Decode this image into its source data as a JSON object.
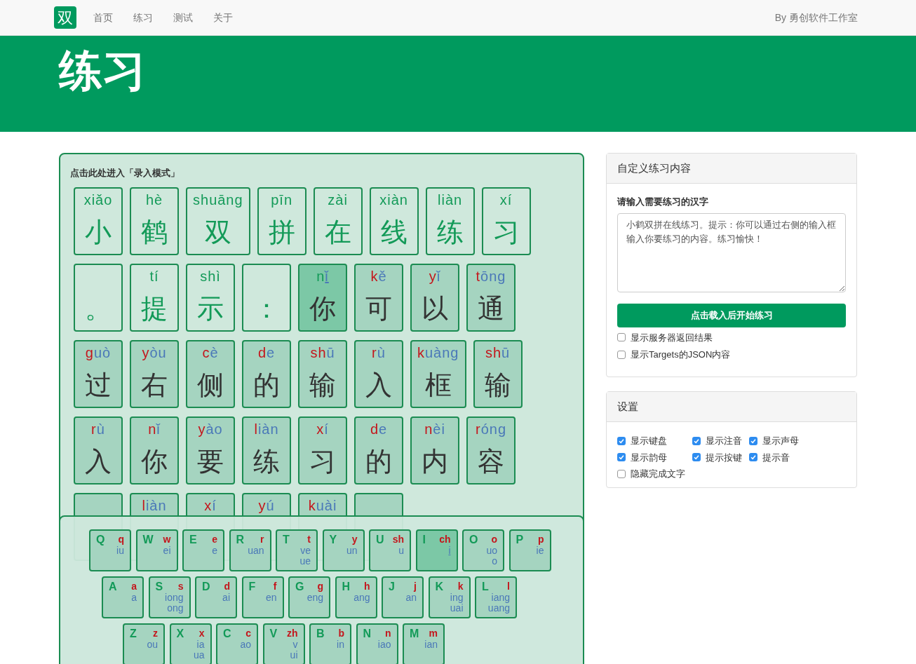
{
  "navbar": {
    "logo": "双",
    "links": [
      "首页",
      "练习",
      "测试",
      "关于"
    ],
    "credit": "By 勇创软件工作室"
  },
  "hero": {
    "title": "练习"
  },
  "practice": {
    "hint": "点击此处进入「录入模式」",
    "rows": [
      [
        {
          "char": "小",
          "initial": "x",
          "final": "iǎo",
          "done": true,
          "selected": false
        },
        {
          "char": "鹤",
          "initial": "h",
          "final": "è",
          "done": true,
          "selected": false
        },
        {
          "char": "双",
          "initial": "sh",
          "final": "uāng",
          "done": true,
          "selected": false
        },
        {
          "char": "拼",
          "initial": "p",
          "final": "īn",
          "done": true,
          "selected": false
        },
        {
          "char": "在",
          "initial": "z",
          "final": "ài",
          "done": true,
          "selected": false
        },
        {
          "char": "线",
          "initial": "x",
          "final": "iàn",
          "done": true,
          "selected": false
        },
        {
          "char": "练",
          "initial": "l",
          "final": "iàn",
          "done": true,
          "selected": false
        },
        {
          "char": "习",
          "initial": "x",
          "final": "í",
          "done": true,
          "selected": false
        }
      ],
      [
        {
          "char": "。",
          "done": true,
          "selected": false
        },
        {
          "char": "提",
          "initial": "t",
          "final": "í",
          "done": true,
          "selected": false
        },
        {
          "char": "示",
          "initial": "sh",
          "final": "ì",
          "done": true,
          "selected": false
        },
        {
          "char": "：",
          "done": true,
          "selected": false
        },
        {
          "char": "你",
          "initial": "n",
          "final": "ǐ",
          "done": false,
          "selected": true
        },
        {
          "char": "可",
          "initial": "k",
          "final": "ě",
          "done": false,
          "selected": false
        },
        {
          "char": "以",
          "initial": "y",
          "final": "ǐ",
          "done": false,
          "selected": false
        },
        {
          "char": "通",
          "initial": "t",
          "final": "ōng",
          "done": false,
          "selected": false
        }
      ],
      [
        {
          "char": "过",
          "initial": "g",
          "final": "uò",
          "done": false,
          "selected": false
        },
        {
          "char": "右",
          "initial": "y",
          "final": "òu",
          "done": false,
          "selected": false
        },
        {
          "char": "侧",
          "initial": "c",
          "final": "è",
          "done": false,
          "selected": false
        },
        {
          "char": "的",
          "initial": "d",
          "final": "e",
          "done": false,
          "selected": false
        },
        {
          "char": "输",
          "initial": "sh",
          "final": "ū",
          "done": false,
          "selected": false
        },
        {
          "char": "入",
          "initial": "r",
          "final": "ù",
          "done": false,
          "selected": false
        },
        {
          "char": "框",
          "initial": "k",
          "final": "uàng",
          "done": false,
          "selected": false
        },
        {
          "char": "输",
          "initial": "sh",
          "final": "ū",
          "done": false,
          "selected": false
        }
      ],
      [
        {
          "char": "入",
          "initial": "r",
          "final": "ù",
          "done": false,
          "selected": false
        },
        {
          "char": "你",
          "initial": "n",
          "final": "ǐ",
          "done": false,
          "selected": false
        },
        {
          "char": "要",
          "initial": "y",
          "final": "ào",
          "done": false,
          "selected": false
        },
        {
          "char": "练",
          "initial": "l",
          "final": "iàn",
          "done": false,
          "selected": false
        },
        {
          "char": "习",
          "initial": "x",
          "final": "í",
          "done": false,
          "selected": false
        },
        {
          "char": "的",
          "initial": "d",
          "final": "e",
          "done": false,
          "selected": false
        },
        {
          "char": "内",
          "initial": "n",
          "final": "èi",
          "done": false,
          "selected": false
        },
        {
          "char": "容",
          "initial": "r",
          "final": "óng",
          "done": false,
          "selected": false
        }
      ],
      [
        {
          "done": false,
          "selected": false
        },
        {
          "initial": "l",
          "final": "iàn",
          "done": false,
          "selected": false
        },
        {
          "initial": "x",
          "final": "í",
          "done": false,
          "selected": false
        },
        {
          "initial": "y",
          "final": "ú",
          "done": false,
          "selected": false
        },
        {
          "initial": "k",
          "final": "uài",
          "done": false,
          "selected": false
        },
        {
          "done": false,
          "selected": false
        }
      ]
    ]
  },
  "keyboard": {
    "rows": [
      [
        {
          "letter": "Q",
          "initial": "q",
          "finals": [
            "iu"
          ],
          "selected": false
        },
        {
          "letter": "W",
          "initial": "w",
          "finals": [
            "ei"
          ],
          "selected": false
        },
        {
          "letter": "E",
          "initial": "e",
          "finals": [
            "e"
          ],
          "selected": false
        },
        {
          "letter": "R",
          "initial": "r",
          "finals": [
            "uan"
          ],
          "selected": false
        },
        {
          "letter": "T",
          "initial": "t",
          "finals": [
            "ve",
            "ue"
          ],
          "selected": false
        },
        {
          "letter": "Y",
          "initial": "y",
          "finals": [
            "un"
          ],
          "selected": false
        },
        {
          "letter": "U",
          "initial": "sh",
          "finals": [
            "u"
          ],
          "selected": false
        },
        {
          "letter": "I",
          "initial": "ch",
          "finals": [
            "i"
          ],
          "selected": true
        },
        {
          "letter": "O",
          "initial": "o",
          "finals": [
            "uo",
            "o"
          ],
          "selected": false
        },
        {
          "letter": "P",
          "initial": "p",
          "finals": [
            "ie"
          ],
          "selected": false
        }
      ],
      [
        {
          "letter": "A",
          "initial": "a",
          "finals": [
            "a"
          ],
          "selected": false
        },
        {
          "letter": "S",
          "initial": "s",
          "finals": [
            "iong",
            "ong"
          ],
          "selected": false
        },
        {
          "letter": "D",
          "initial": "d",
          "finals": [
            "ai"
          ],
          "selected": false
        },
        {
          "letter": "F",
          "initial": "f",
          "finals": [
            "en"
          ],
          "selected": false
        },
        {
          "letter": "G",
          "initial": "g",
          "finals": [
            "eng"
          ],
          "selected": false
        },
        {
          "letter": "H",
          "initial": "h",
          "finals": [
            "ang"
          ],
          "selected": false
        },
        {
          "letter": "J",
          "initial": "j",
          "finals": [
            "an"
          ],
          "selected": false
        },
        {
          "letter": "K",
          "initial": "k",
          "finals": [
            "ing",
            "uai"
          ],
          "selected": false
        },
        {
          "letter": "L",
          "initial": "l",
          "finals": [
            "iang",
            "uang"
          ],
          "selected": false
        }
      ],
      [
        {
          "letter": "Z",
          "initial": "z",
          "finals": [
            "ou"
          ],
          "selected": false
        },
        {
          "letter": "X",
          "initial": "x",
          "finals": [
            "ia",
            "ua"
          ],
          "selected": false
        },
        {
          "letter": "C",
          "initial": "c",
          "finals": [
            "ao"
          ],
          "selected": false
        },
        {
          "letter": "V",
          "initial": "zh",
          "finals": [
            "v",
            "ui"
          ],
          "selected": false
        },
        {
          "letter": "B",
          "initial": "b",
          "finals": [
            "in"
          ],
          "selected": false
        },
        {
          "letter": "N",
          "initial": "n",
          "finals": [
            "iao"
          ],
          "selected": false
        },
        {
          "letter": "M",
          "initial": "m",
          "finals": [
            "ian"
          ],
          "selected": false
        }
      ]
    ]
  },
  "custom": {
    "title": "自定义练习内容",
    "label": "请输入需要练习的汉字",
    "value": "小鹤双拼在线练习。提示：你可以通过右侧的输入框输入你要练习的内容。练习愉快！",
    "button": "点击载入后开始练习",
    "options": [
      {
        "label": "显示服务器返回结果",
        "checked": false
      },
      {
        "label": "显示Targets的JSON内容",
        "checked": false
      }
    ]
  },
  "settings": {
    "title": "设置",
    "options": [
      {
        "label": "显示键盘",
        "checked": true
      },
      {
        "label": "显示注音",
        "checked": true
      },
      {
        "label": "显示声母",
        "checked": true
      },
      {
        "label": "显示韵母",
        "checked": true
      },
      {
        "label": "提示按键",
        "checked": true
      },
      {
        "label": "提示音",
        "checked": true
      },
      {
        "label": "隐藏完成文字",
        "checked": false
      }
    ]
  }
}
